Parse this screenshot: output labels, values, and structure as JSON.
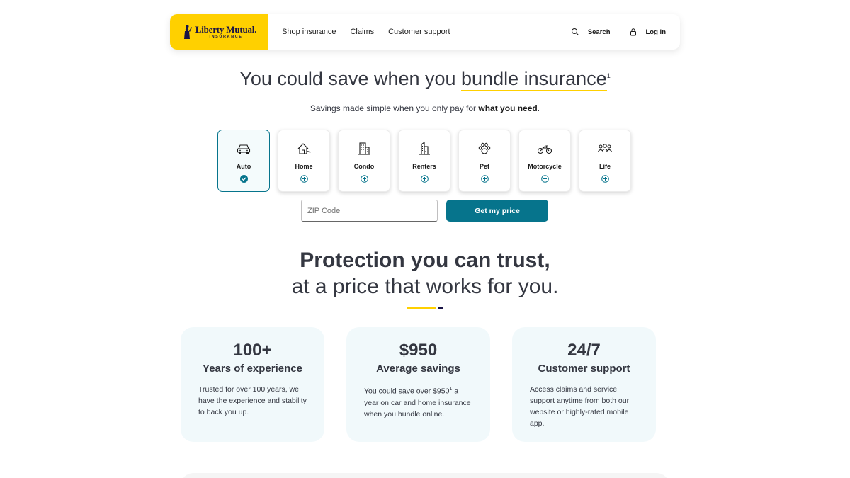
{
  "header": {
    "logo_name": "Liberty Mutual.",
    "logo_sub": "INSURANCE",
    "nav": [
      "Shop insurance",
      "Claims",
      "Customer support"
    ],
    "search_label": "Search",
    "login_label": "Log in"
  },
  "hero": {
    "title_pre": "You could save when you ",
    "title_underlined": "bundle insurance",
    "title_sup": "1",
    "subtitle_pre": "Savings made simple when you only pay for ",
    "subtitle_bold": "what you need",
    "subtitle_post": "."
  },
  "products": [
    {
      "label": "Auto",
      "icon": "car-icon",
      "selected": true
    },
    {
      "label": "Home",
      "icon": "house-icon",
      "selected": false
    },
    {
      "label": "Condo",
      "icon": "building-icon",
      "selected": false
    },
    {
      "label": "Renters",
      "icon": "apartment-icon",
      "selected": false
    },
    {
      "label": "Pet",
      "icon": "paw-icon",
      "selected": false
    },
    {
      "label": "Motorcycle",
      "icon": "motorcycle-icon",
      "selected": false
    },
    {
      "label": "Life",
      "icon": "people-icon",
      "selected": false
    }
  ],
  "quote": {
    "zip_placeholder": "ZIP Code",
    "zip_value": "",
    "cta_label": "Get my price"
  },
  "protection": {
    "title": "Protection you can trust,",
    "subtitle": "at a price that works for you."
  },
  "stats": [
    {
      "big": "100+",
      "label": "Years of experience",
      "desc_pre": "Trusted for over 100 years, we have the experience and stability to back you up.",
      "desc_sup": "",
      "desc_post": ""
    },
    {
      "big": "$950",
      "label": "Average savings",
      "desc_pre": "You could save over $950",
      "desc_sup": "1",
      "desc_post": " a year on car and home insurance when you bundle online."
    },
    {
      "big": "24/7",
      "label": "Customer support",
      "desc_pre": "Access claims and service support anytime from both our website or highly-rated mobile app.",
      "desc_sup": "",
      "desc_post": ""
    }
  ],
  "colors": {
    "brand_yellow": "#ffd000",
    "brand_navy": "#1a1446",
    "teal": "#06748c",
    "stat_bg": "#f1f9fb"
  }
}
